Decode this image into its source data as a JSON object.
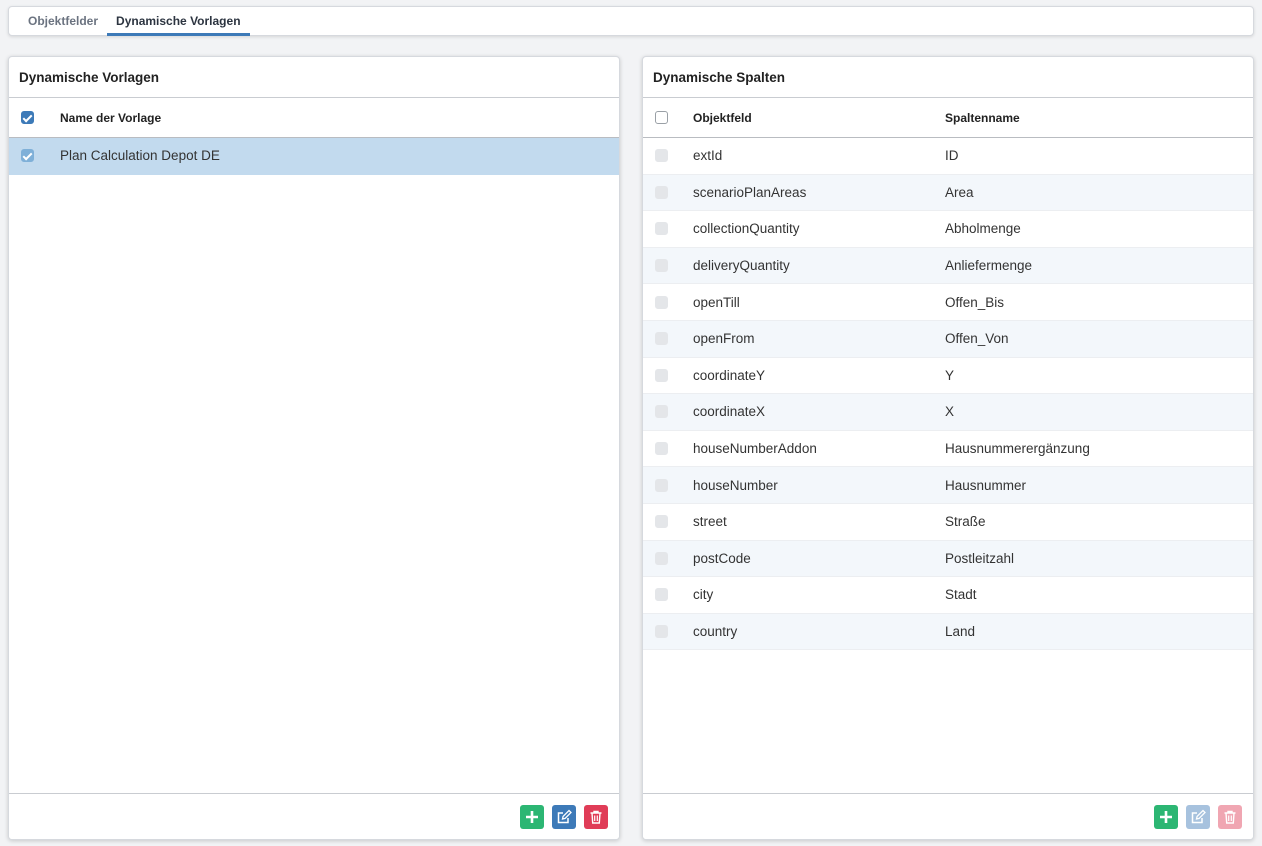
{
  "tabs": [
    {
      "label": "Objektfelder",
      "active": false
    },
    {
      "label": "Dynamische Vorlagen",
      "active": true
    }
  ],
  "left_panel": {
    "title": "Dynamische Vorlagen",
    "header": {
      "name": "Name der Vorlage"
    },
    "rows": [
      {
        "name": "Plan Calculation Depot DE",
        "selected": true
      }
    ],
    "buttons": {
      "add": "plus-icon",
      "edit": "edit-icon",
      "delete": "trash-icon"
    }
  },
  "right_panel": {
    "title": "Dynamische Spalten",
    "header": {
      "field": "Objektfeld",
      "column": "Spaltenname"
    },
    "rows": [
      {
        "field": "extId",
        "column": "ID"
      },
      {
        "field": "scenarioPlanAreas",
        "column": "Area"
      },
      {
        "field": "collectionQuantity",
        "column": "Abholmenge"
      },
      {
        "field": "deliveryQuantity",
        "column": "Anliefermenge"
      },
      {
        "field": "openTill",
        "column": "Offen_Bis"
      },
      {
        "field": "openFrom",
        "column": "Offen_Von"
      },
      {
        "field": "coordinateY",
        "column": "Y"
      },
      {
        "field": "coordinateX",
        "column": "X"
      },
      {
        "field": "houseNumberAddon",
        "column": "Hausnummerergänzung"
      },
      {
        "field": "houseNumber",
        "column": "Hausnummer"
      },
      {
        "field": "street",
        "column": "Straße"
      },
      {
        "field": "postCode",
        "column": "Postleitzahl"
      },
      {
        "field": "city",
        "column": "Stadt"
      },
      {
        "field": "country",
        "column": "Land"
      }
    ],
    "buttons": {
      "add": "plus-icon",
      "edit": "edit-icon",
      "delete": "trash-icon"
    }
  },
  "colors": {
    "accent": "#3d7ab8",
    "add": "#2cb673",
    "delete": "#e03c57",
    "selected_row": "#c2daee"
  }
}
